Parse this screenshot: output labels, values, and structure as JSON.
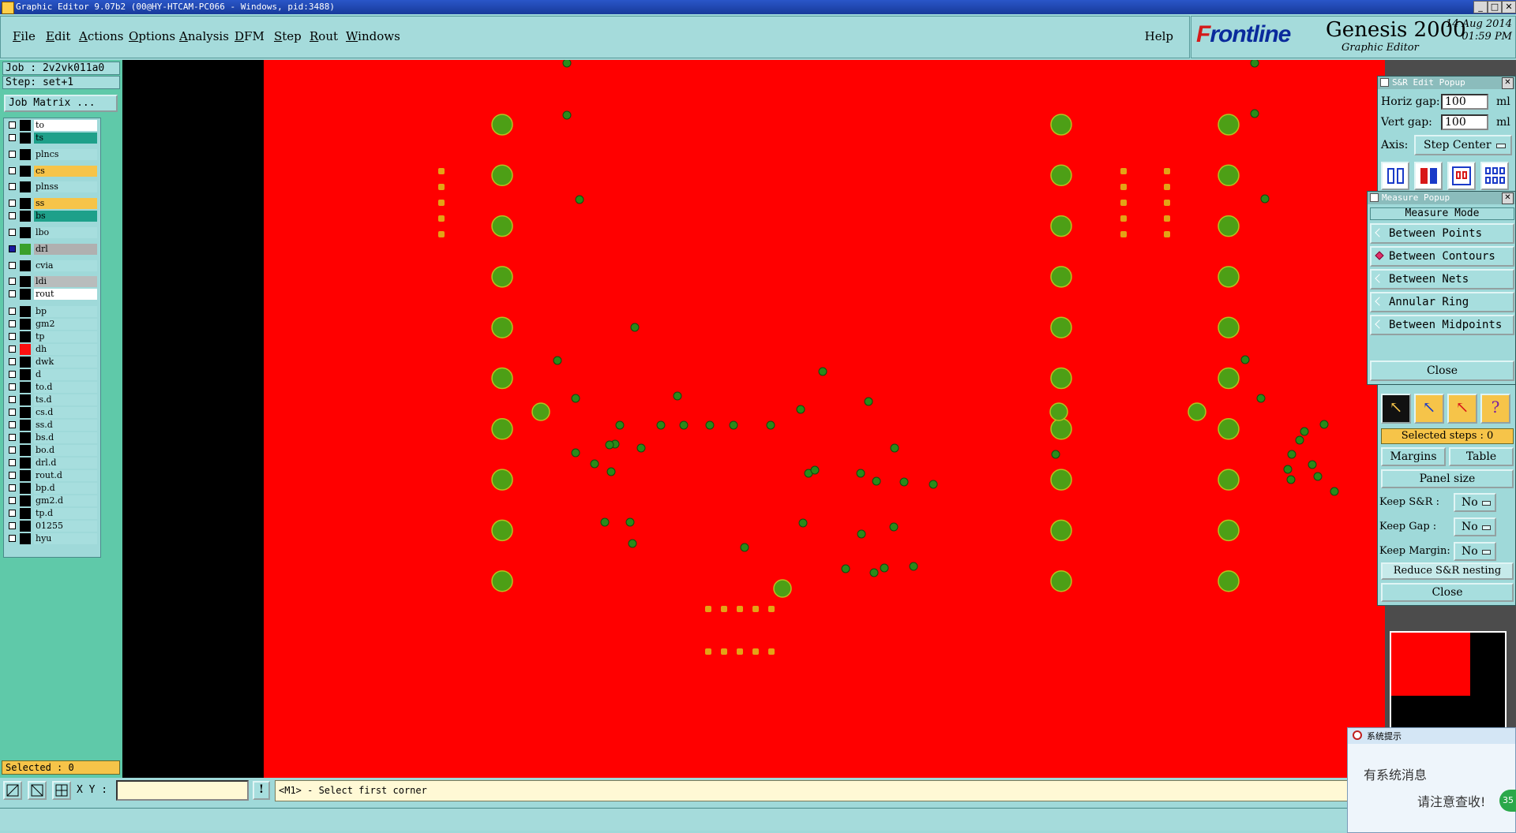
{
  "window": {
    "title": "Graphic Editor 9.07b2 (00@HY-HTCAM-PC066 - Windows, pid:3488)",
    "min": "_",
    "max": "□",
    "close": "✕"
  },
  "menu": {
    "items": [
      "File",
      "Edit",
      "Actions",
      "Options",
      "Analysis",
      "DFM",
      "Step",
      "Rout",
      "Windows"
    ],
    "help": "Help"
  },
  "brand": {
    "logo_f": "F",
    "logo_rest": "rontline",
    "product": "Genesis 2000",
    "subtitle": "Graphic Editor",
    "date": "14 Aug 2014",
    "time": "01:59 PM"
  },
  "job": {
    "job": "Job : 2v2vk011a0",
    "step": "Step: set+1",
    "job_matrix": "Job Matrix ..."
  },
  "layers": [
    {
      "name": "to",
      "bg": "#ffffff"
    },
    {
      "name": "ts",
      "bg": "#1ea08a"
    },
    {
      "name": "plncs",
      "bg": "#a7dede"
    },
    {
      "name": "cs",
      "bg": "#f6c449"
    },
    {
      "name": "plnss",
      "bg": "#a7dede"
    },
    {
      "name": "ss",
      "bg": "#f6c449"
    },
    {
      "name": "bs",
      "bg": "#1ea08a"
    },
    {
      "name": "lbo",
      "bg": "#a7dede"
    },
    {
      "name": "drl",
      "bg": "#b0b0b0"
    },
    {
      "name": "cvia",
      "bg": "#a7dede"
    },
    {
      "name": "ldi",
      "bg": "#b8bcbc"
    },
    {
      "name": "rout",
      "bg": "#ffffff"
    },
    {
      "name": "bp",
      "bg": "#a7dede"
    },
    {
      "name": "gm2",
      "bg": "#a7dede"
    },
    {
      "name": "tp",
      "bg": "#a7dede"
    },
    {
      "name": "dh",
      "bg": "#a7dede"
    },
    {
      "name": "dwk",
      "bg": "#a7dede"
    },
    {
      "name": "d",
      "bg": "#a7dede"
    },
    {
      "name": "to.d",
      "bg": "#a7dede"
    },
    {
      "name": "ts.d",
      "bg": "#a7dede"
    },
    {
      "name": "cs.d",
      "bg": "#a7dede"
    },
    {
      "name": "ss.d",
      "bg": "#a7dede"
    },
    {
      "name": "bs.d",
      "bg": "#a7dede"
    },
    {
      "name": "bo.d",
      "bg": "#a7dede"
    },
    {
      "name": "drl.d",
      "bg": "#a7dede"
    },
    {
      "name": "rout.d",
      "bg": "#a7dede"
    },
    {
      "name": "bp.d",
      "bg": "#a7dede"
    },
    {
      "name": "gm2.d",
      "bg": "#a7dede"
    },
    {
      "name": "tp.d",
      "bg": "#a7dede"
    },
    {
      "name": "01255",
      "bg": "#a7dede"
    },
    {
      "name": "hyu",
      "bg": "#a7dede"
    }
  ],
  "selected": "Selected : 0",
  "bottom": {
    "xy_label": "X Y :",
    "xy_value": "",
    "bang": "!",
    "prompt": "<M1> - Select first corner"
  },
  "sr_popup": {
    "title": "S&R Edit Popup",
    "horiz_label": "Horiz gap:",
    "horiz_value": "100",
    "horiz_unit": "ml",
    "vert_label": "Vert  gap:",
    "vert_value": "100",
    "vert_unit": "ml",
    "axis_label": "Axis:",
    "axis_value": "Step Center",
    "selected_steps": "Selected steps : 0",
    "margins": "Margins",
    "table": "Table",
    "panel_size": "Panel size",
    "keep_sr_label": "Keep S&R   :",
    "keep_sr_value": "No",
    "keep_gap_label": "Keep Gap    :",
    "keep_gap_value": "No",
    "keep_margin_label": "Keep Margin:",
    "keep_margin_value": "No",
    "reduce": "Reduce S&R nesting",
    "close": "Close"
  },
  "measure_popup": {
    "title": "Measure Popup",
    "mode_label": "Measure Mode",
    "options": [
      "Between Points",
      "Between Contours",
      "Between Nets",
      "Annular Ring",
      "Between Midpoints"
    ],
    "selected_index": 1,
    "close": "Close"
  },
  "toast": {
    "title": "系统提示",
    "line1": "有系统消息",
    "line2": "请注意查收!",
    "badge": "35"
  },
  "colors": {
    "board": "#ff0000",
    "pad": "#4d9f16",
    "via": "#2a8a1a",
    "smd": "#e3a316"
  }
}
